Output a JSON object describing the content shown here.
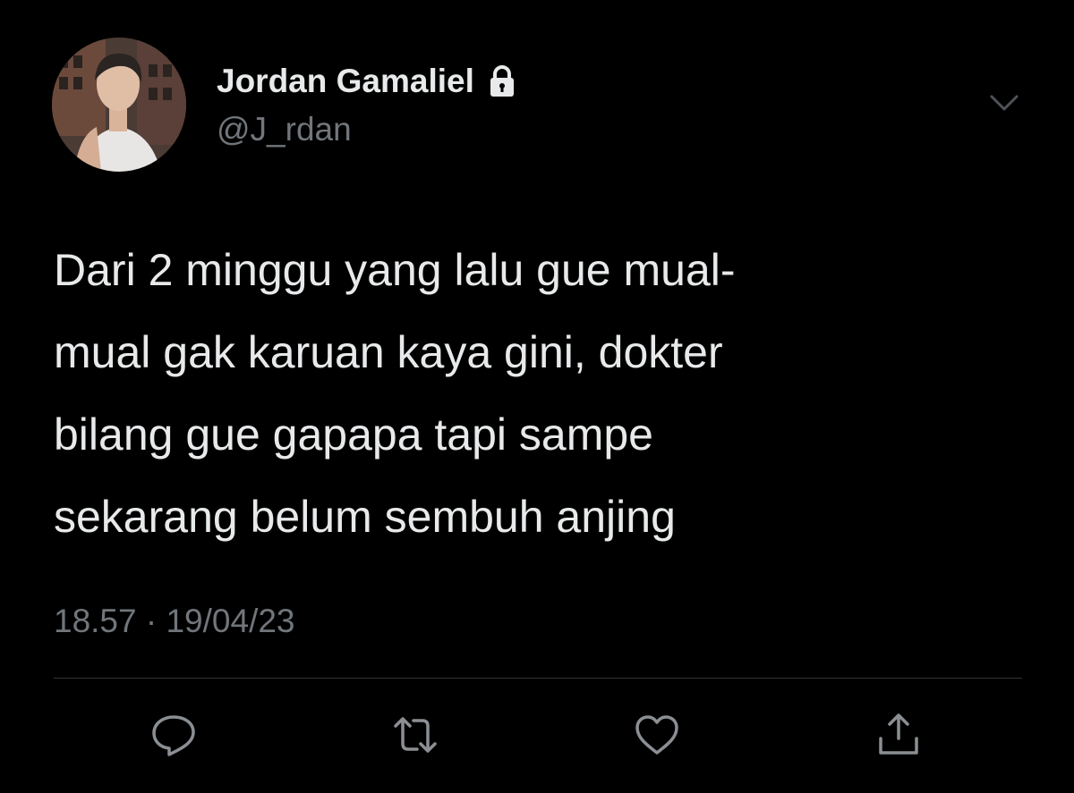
{
  "tweet": {
    "author": {
      "name": "Jordan Gamaliel",
      "handle": "@J_rdan",
      "verified_lock_icon": "lock-icon",
      "avatar_icon": "avatar"
    },
    "text_lines": [
      "Dari 2 minggu yang lalu gue mual-",
      "mual gak karuan kaya gini, dokter",
      "bilang gue gapapa tapi sampe",
      "sekarang belum sembuh anjing"
    ],
    "time": "18.57",
    "separator": "·",
    "date": "19/04/23",
    "actions": [
      {
        "name": "reply-icon"
      },
      {
        "name": "retweet-icon"
      },
      {
        "name": "like-icon"
      },
      {
        "name": "share-icon"
      }
    ]
  },
  "colors": {
    "background": "#000000",
    "text_primary": "#e7e9ea",
    "text_secondary": "#71767b",
    "divider": "#2f3336"
  }
}
